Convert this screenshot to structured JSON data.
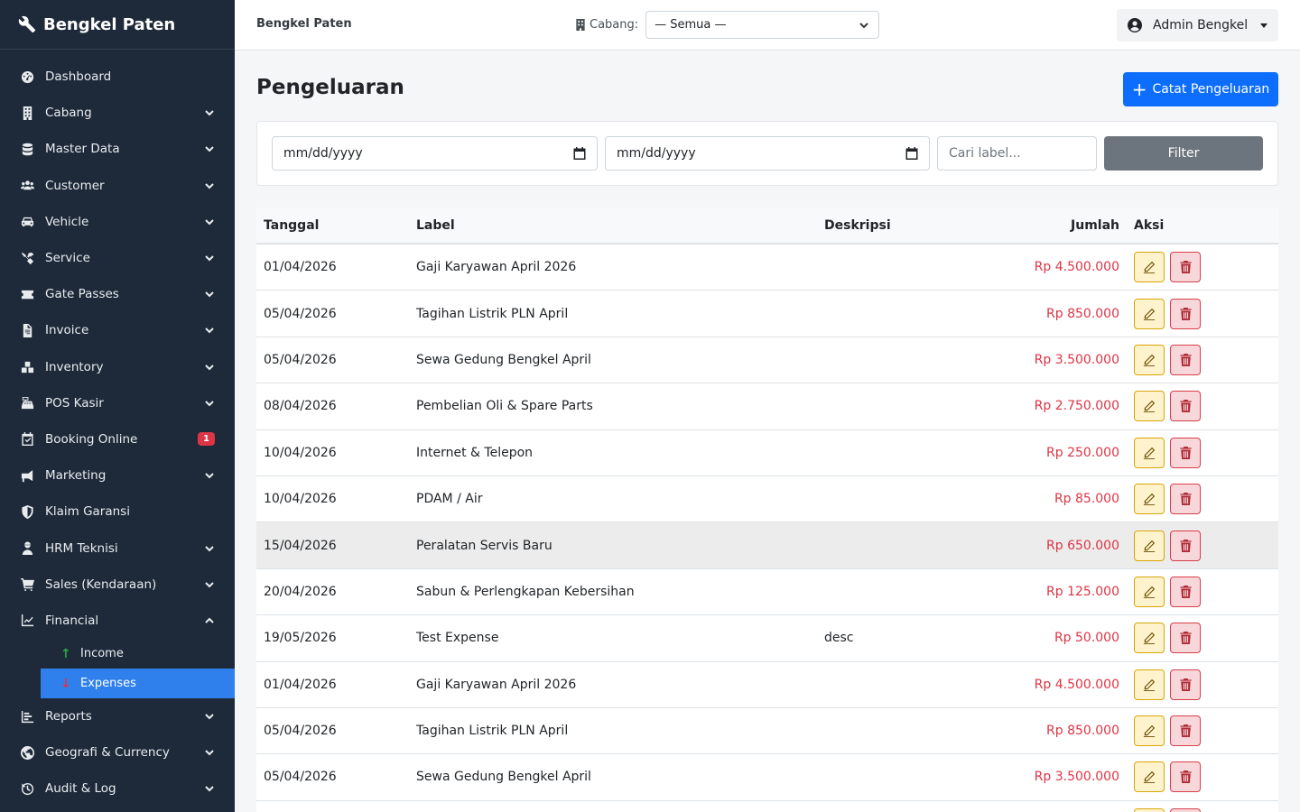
{
  "brand": {
    "title": "Bengkel Paten"
  },
  "sidebar": {
    "items": [
      {
        "label": "Dashboard",
        "icon": "gauge-icon",
        "chevron": false
      },
      {
        "label": "Cabang",
        "icon": "building-icon",
        "chevron": true
      },
      {
        "label": "Master Data",
        "icon": "database-icon",
        "chevron": true
      },
      {
        "label": "Customer",
        "icon": "users-icon",
        "chevron": true
      },
      {
        "label": "Vehicle",
        "icon": "car-icon",
        "chevron": true
      },
      {
        "label": "Service",
        "icon": "tools-icon",
        "chevron": true
      },
      {
        "label": "Gate Passes",
        "icon": "ticket-icon",
        "chevron": true
      },
      {
        "label": "Invoice",
        "icon": "file-invoice-icon",
        "chevron": true
      },
      {
        "label": "Inventory",
        "icon": "boxes-icon",
        "chevron": true
      },
      {
        "label": "POS Kasir",
        "icon": "cash-register-icon",
        "chevron": true
      },
      {
        "label": "Booking Online",
        "icon": "calendar-check-icon",
        "chevron": false,
        "badge": "1"
      },
      {
        "label": "Marketing",
        "icon": "bullhorn-icon",
        "chevron": true
      },
      {
        "label": "Klaim Garansi",
        "icon": "shield-icon",
        "chevron": false
      },
      {
        "label": "HRM Teknisi",
        "icon": "user-worker-icon",
        "chevron": true
      },
      {
        "label": "Sales (Kendaraan)",
        "icon": "cart-icon",
        "chevron": true
      },
      {
        "label": "Financial",
        "icon": "chart-line-icon",
        "chevron": true,
        "expanded": true
      }
    ],
    "sub_items": [
      {
        "label": "Income",
        "icon": "arrow-up-icon",
        "color": "#28a745"
      },
      {
        "label": "Expenses",
        "icon": "arrow-down-icon",
        "color": "#dc3545",
        "active": true
      }
    ],
    "items_after": [
      {
        "label": "Reports",
        "icon": "list-chart-icon",
        "chevron": true
      },
      {
        "label": "Geografi & Currency",
        "icon": "globe-icon",
        "chevron": true
      },
      {
        "label": "Audit & Log",
        "icon": "history-icon",
        "chevron": true
      }
    ]
  },
  "topbar": {
    "site_name": "Bengkel Paten",
    "branch_label": "Cabang:",
    "branch_value": "— Semua —",
    "user_name": "Admin Bengkel"
  },
  "page": {
    "title": "Pengeluaran",
    "add_button": "Catat Pengeluaran"
  },
  "filter": {
    "date_from_placeholder": "mm/dd/yyyy",
    "date_to_placeholder": "mm/dd/yyyy",
    "search_placeholder": "Cari label...",
    "filter_button": "Filter"
  },
  "table": {
    "headers": {
      "date": "Tanggal",
      "label": "Label",
      "desc": "Deskripsi",
      "amount": "Jumlah",
      "actions": "Aksi"
    },
    "rows": [
      {
        "date": "01/04/2026",
        "label": "Gaji Karyawan April 2026",
        "desc": "",
        "amount": "Rp 4.500.000"
      },
      {
        "date": "05/04/2026",
        "label": "Tagihan Listrik PLN April",
        "desc": "",
        "amount": "Rp 850.000"
      },
      {
        "date": "05/04/2026",
        "label": "Sewa Gedung Bengkel April",
        "desc": "",
        "amount": "Rp 3.500.000"
      },
      {
        "date": "08/04/2026",
        "label": "Pembelian Oli & Spare Parts",
        "desc": "",
        "amount": "Rp 2.750.000"
      },
      {
        "date": "10/04/2026",
        "label": "Internet & Telepon",
        "desc": "",
        "amount": "Rp 250.000"
      },
      {
        "date": "10/04/2026",
        "label": "PDAM / Air",
        "desc": "",
        "amount": "Rp 85.000"
      },
      {
        "date": "15/04/2026",
        "label": "Peralatan Servis Baru",
        "desc": "",
        "amount": "Rp 650.000",
        "hover": true
      },
      {
        "date": "20/04/2026",
        "label": "Sabun & Perlengkapan Kebersihan",
        "desc": "",
        "amount": "Rp 125.000"
      },
      {
        "date": "19/05/2026",
        "label": "Test Expense",
        "desc": "desc",
        "amount": "Rp 50.000"
      },
      {
        "date": "01/04/2026",
        "label": "Gaji Karyawan April 2026",
        "desc": "",
        "amount": "Rp 4.500.000"
      },
      {
        "date": "05/04/2026",
        "label": "Tagihan Listrik PLN April",
        "desc": "",
        "amount": "Rp 850.000"
      },
      {
        "date": "05/04/2026",
        "label": "Sewa Gedung Bengkel April",
        "desc": "",
        "amount": "Rp 3.500.000"
      },
      {
        "date": "",
        "label": "",
        "desc": "",
        "amount": ""
      }
    ]
  }
}
